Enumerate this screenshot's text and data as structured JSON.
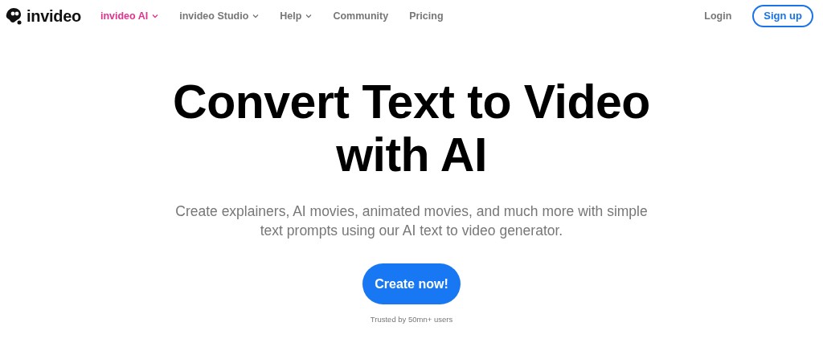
{
  "logo": {
    "text": "invideo"
  },
  "nav": [
    {
      "label": "invideo AI",
      "selected": true,
      "dropdown": true
    },
    {
      "label": "invideo Studio",
      "selected": false,
      "dropdown": true
    },
    {
      "label": "Help",
      "selected": false,
      "dropdown": true
    },
    {
      "label": "Community",
      "selected": false,
      "dropdown": false
    },
    {
      "label": "Pricing",
      "selected": false,
      "dropdown": false
    }
  ],
  "login": "Login",
  "signup": "Sign up",
  "hero": {
    "title_lines": [
      "Convert Text to Video",
      "with AI"
    ],
    "subtitle_lines": [
      "Create explainers, AI movies, animated movies, and much more with simple",
      "text prompts using our AI text to video generator."
    ],
    "cta": "Create now!",
    "trust": "Trusted by 50mn+ users"
  }
}
